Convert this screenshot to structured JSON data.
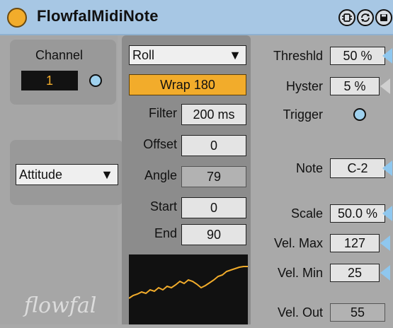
{
  "header": {
    "title": "FlowfalMidiNote",
    "icons": [
      "device-icon",
      "refresh-icon",
      "save-icon"
    ]
  },
  "left": {
    "channel_label": "Channel",
    "channel_value": "1",
    "mode_value": "Attitude",
    "brand": "flowfal"
  },
  "mid": {
    "roll_value": "Roll",
    "wrap_label": "Wrap 180",
    "filter_label": "Filter",
    "filter_value": "200 ms",
    "offset_label": "Offset",
    "offset_value": "0",
    "angle_label": "Angle",
    "angle_value": "79",
    "start_label": "Start",
    "start_value": "0",
    "end_label": "End",
    "end_value": "90"
  },
  "right": {
    "thresh_label": "Threshld",
    "thresh_value": "50 %",
    "hyster_label": "Hyster",
    "hyster_value": "5 %",
    "trigger_label": "Trigger",
    "note_label": "Note",
    "note_value": "C-2",
    "scale_label": "Scale",
    "scale_value": "50.0 %",
    "velmax_label": "Vel. Max",
    "velmax_value": "127",
    "velmin_label": "Vel. Min",
    "velmin_value": "25",
    "velout_label": "Vel. Out",
    "velout_value": "55"
  },
  "colors": {
    "accent": "#f2ac2b",
    "led": "#9fd1ee",
    "arrow": "#8fc7ee",
    "title_bar": "#a7c7e4"
  }
}
